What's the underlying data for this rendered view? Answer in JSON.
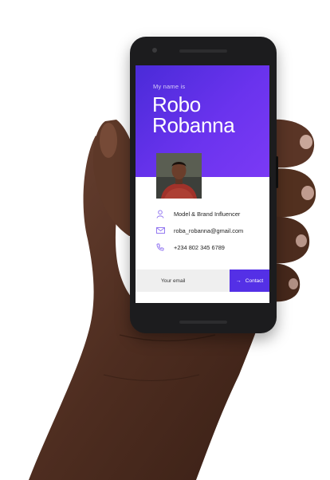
{
  "card": {
    "kicker": "My name is",
    "first_name": "Robo",
    "last_name": "Robanna",
    "accent": "#5430e6",
    "gradient_start": "#4a2bd8",
    "gradient_end": "#7b3af5"
  },
  "details": [
    {
      "icon": "person-icon",
      "text": "Model & Brand Influencer"
    },
    {
      "icon": "mail-icon",
      "text": "roba_robanna@gmail.com"
    },
    {
      "icon": "phone-icon",
      "text": "+234 802 345 6789"
    }
  ],
  "contact": {
    "placeholder": "Your email",
    "button_label": "Contact",
    "button_icon": "arrow-right-icon"
  }
}
